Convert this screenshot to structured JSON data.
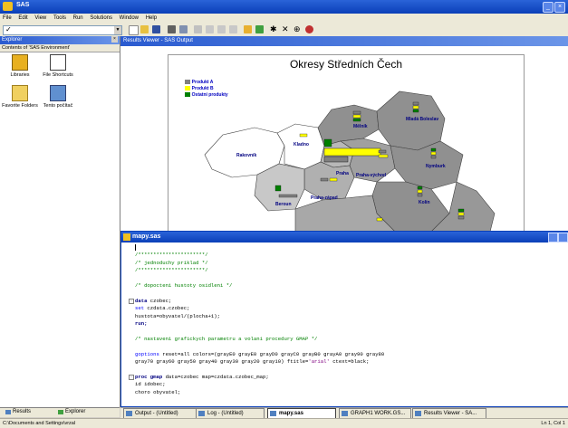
{
  "app": {
    "title": "SAS"
  },
  "menu": [
    "File",
    "Edit",
    "View",
    "Tools",
    "Run",
    "Solutions",
    "Window",
    "Help"
  ],
  "command_box": {
    "value": ""
  },
  "explorer": {
    "title": "Explorer",
    "contents_label": "Contents of 'SAS Environment'",
    "items": [
      {
        "label": "Libraries",
        "icon": "libraries-icon"
      },
      {
        "label": "File Shortcuts",
        "icon": "file-shortcuts-icon"
      },
      {
        "label": "Favorite Folders",
        "icon": "favorite-folders-icon"
      },
      {
        "label": "Tento počítač",
        "icon": "my-computer-icon"
      }
    ],
    "tabs": [
      "Results",
      "Explorer"
    ]
  },
  "results_viewer": {
    "title": "Results Viewer - SAS Output"
  },
  "map": {
    "title": "Okresy Středních Čech",
    "legend": [
      {
        "label": "Produkt A",
        "color": "#808080"
      },
      {
        "label": "Produkt B",
        "color": "#ffff00"
      },
      {
        "label": "Ostatní produkty",
        "color": "#008000"
      }
    ],
    "districts": [
      {
        "name": "Rakovník"
      },
      {
        "name": "Kladno"
      },
      {
        "name": "Mělník"
      },
      {
        "name": "Mladá Boleslav"
      },
      {
        "name": "Praha"
      },
      {
        "name": "Praha-východ"
      },
      {
        "name": "Praha-západ"
      },
      {
        "name": "Nymburk"
      },
      {
        "name": "Beroun"
      },
      {
        "name": "Kolín"
      }
    ]
  },
  "editor": {
    "title": "mapy.sas",
    "lines": [
      {
        "parts": [
          {
            "t": "",
            "c": ""
          }
        ]
      },
      {
        "parts": [
          {
            "t": "/**********************/",
            "c": "cm"
          }
        ]
      },
      {
        "parts": [
          {
            "t": "/* jednoduchy priklad */",
            "c": "cm"
          }
        ]
      },
      {
        "parts": [
          {
            "t": "/**********************/",
            "c": "cm"
          }
        ]
      },
      {
        "parts": [
          {
            "t": "",
            "c": ""
          }
        ]
      },
      {
        "parts": [
          {
            "t": "/* dopocteni hustoty osidleni */",
            "c": "cm"
          }
        ]
      },
      {
        "parts": [
          {
            "t": "",
            "c": ""
          }
        ]
      },
      {
        "parts": [
          {
            "t": "data",
            "c": "kw"
          },
          {
            "t": " czobec;",
            "c": ""
          }
        ],
        "fold": true
      },
      {
        "parts": [
          {
            "t": "set",
            "c": "kw2"
          },
          {
            "t": " czdata.czobec;",
            "c": ""
          }
        ]
      },
      {
        "parts": [
          {
            "t": "hustota=obyvatel/(plocha+1);",
            "c": ""
          }
        ]
      },
      {
        "parts": [
          {
            "t": "run;",
            "c": "kw"
          }
        ]
      },
      {
        "parts": [
          {
            "t": "",
            "c": ""
          }
        ]
      },
      {
        "parts": [
          {
            "t": "/* nastaveni grafickych parametru a volani procedury GMAP */",
            "c": "cm"
          }
        ]
      },
      {
        "parts": [
          {
            "t": "",
            "c": ""
          }
        ]
      },
      {
        "parts": [
          {
            "t": "goptions",
            "c": "kw2"
          },
          {
            "t": " reset=all colors=(grayE0 grayE0 grayD0 grayC0 grayB0 grayA0 gray90 gray80",
            "c": ""
          }
        ]
      },
      {
        "parts": [
          {
            "t": "gray70 gray60 gray50 gray40 gray30 gray20 gray10) ftitle=",
            "c": ""
          },
          {
            "t": "'arial'",
            "c": "str"
          },
          {
            "t": " ctext=black;",
            "c": ""
          }
        ]
      },
      {
        "parts": [
          {
            "t": "",
            "c": ""
          }
        ]
      },
      {
        "parts": [
          {
            "t": "proc gmap",
            "c": "kw"
          },
          {
            "t": " data=czobec map=czdata.czobec_map;",
            "c": ""
          }
        ],
        "fold": true
      },
      {
        "parts": [
          {
            "t": "id idobec;",
            "c": ""
          }
        ]
      },
      {
        "parts": [
          {
            "t": "choro obyvatel;",
            "c": ""
          }
        ]
      }
    ]
  },
  "taskbar": [
    {
      "label": "Output - (Untitled)",
      "active": false
    },
    {
      "label": "Log - (Untitled)",
      "active": false
    },
    {
      "label": "mapy.sas",
      "active": true
    },
    {
      "label": "GRAPH1 WORK.GS...",
      "active": false
    },
    {
      "label": "Results Viewer - SA...",
      "active": false
    }
  ],
  "status": {
    "path": "C:\\Documents and Settings\\vrzal",
    "position": "Ln 1, Col 1"
  }
}
